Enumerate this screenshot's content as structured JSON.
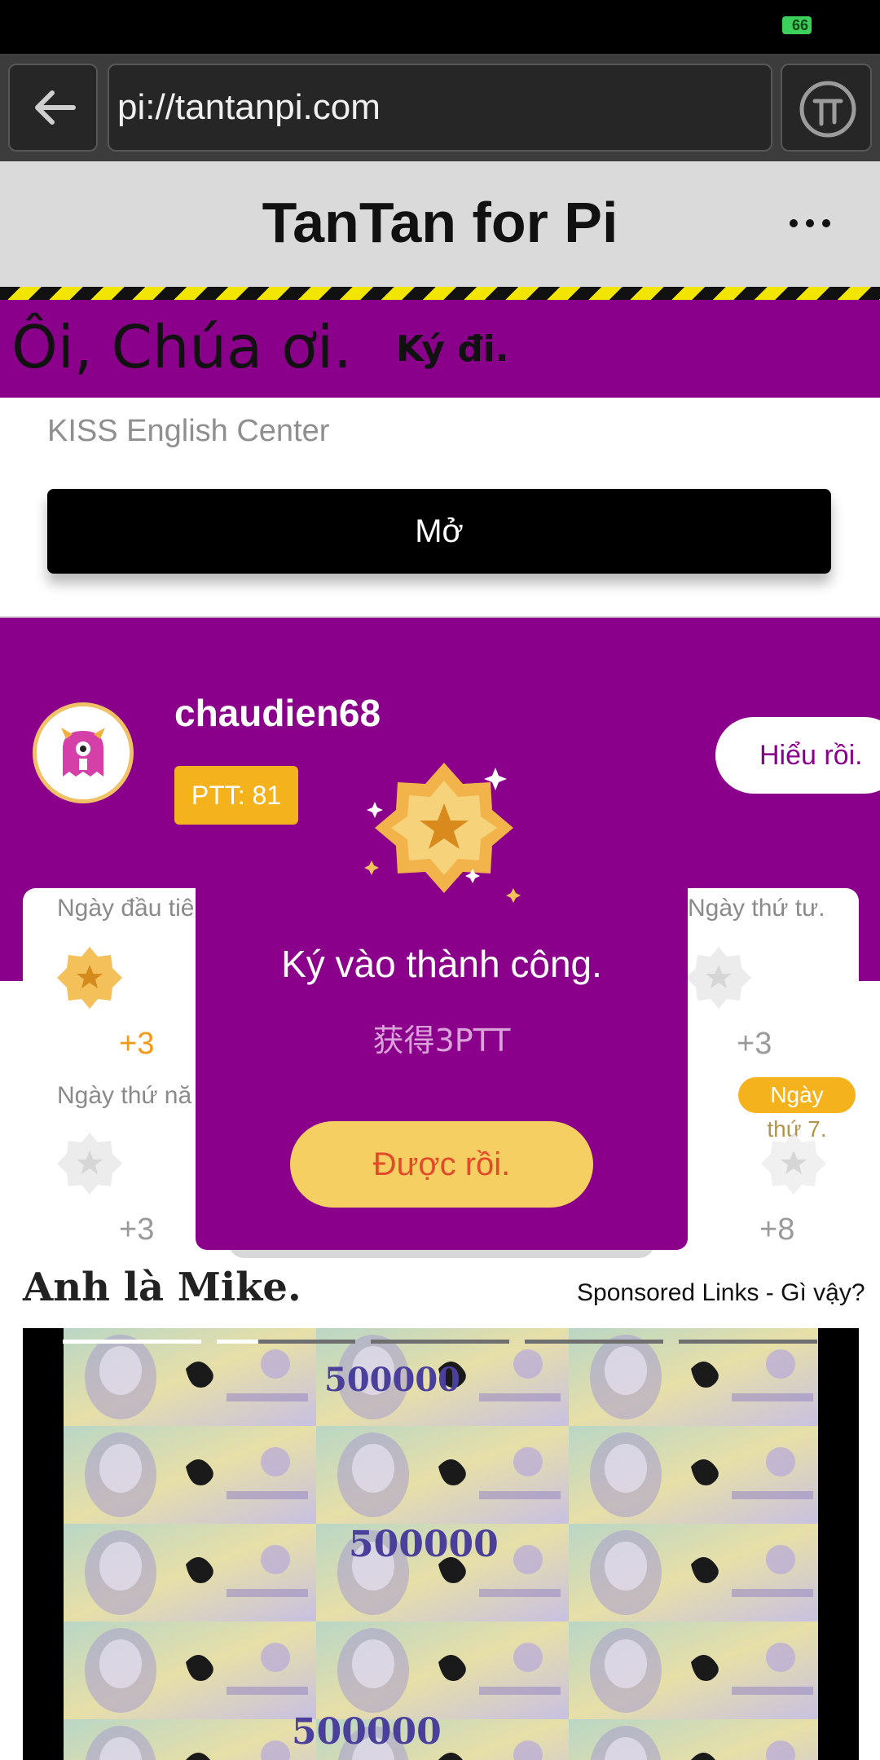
{
  "status_bar": {
    "battery": "66"
  },
  "browser": {
    "url": "pi://tantanpi.com"
  },
  "app": {
    "title": "TanTan for Pi"
  },
  "banner": {
    "big_text": "Ôi, Chúa ơi.",
    "small_text": "Ký đi."
  },
  "ad": {
    "name": "KISS English Center",
    "open_label": "Mở"
  },
  "profile": {
    "username": "chaudien68",
    "ptt_label": "PTT: 81",
    "got_it_label": "Hiểu rồi."
  },
  "checkin": {
    "days": [
      {
        "label": "Ngày đầu tiê",
        "points": "+3",
        "signed": true
      },
      {
        "label": "Ngày thứ tư.",
        "points": "+3",
        "signed": false
      },
      {
        "label": "Ngày thứ nă",
        "points": "+3",
        "signed": false
      },
      {
        "label_line1": "Ngày",
        "label_line2": "thứ 7.",
        "points": "+8",
        "signed": false
      }
    ]
  },
  "modal": {
    "title": "Ký vào thành công.",
    "subtitle": "获得3PTT",
    "ok_label": "Được rồi."
  },
  "sponsored_section": {
    "title": "Anh là Mike.",
    "sponsored_label": "Sponsored Links - Gì vậy?"
  },
  "video": {
    "segments": [
      1.0,
      0.3,
      0.0,
      0.0,
      0.0
    ],
    "note_text": "500000"
  },
  "colors": {
    "accent": "#8b008b",
    "badge": "#f4b21c",
    "ok_button": "#f6cf63"
  },
  "icons": [
    "back-arrow-icon",
    "pi-icon",
    "more-icon",
    "avatar-monster-icon",
    "star-badge-icon"
  ]
}
